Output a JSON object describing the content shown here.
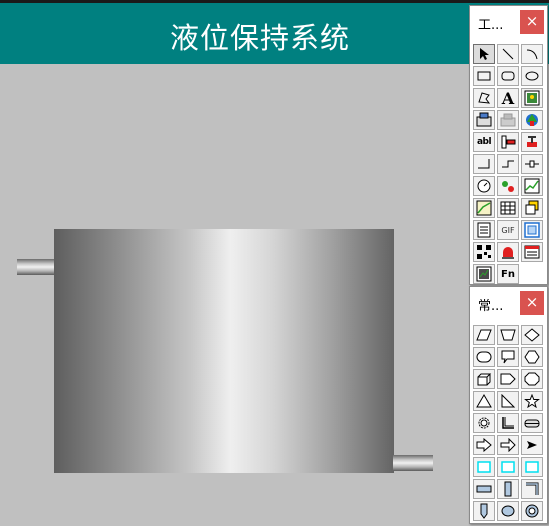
{
  "window": {
    "title": "液位保持系统"
  },
  "palettes": {
    "tools": {
      "title": "工...",
      "close": "×",
      "gif_label": "GIF",
      "text_label": "A",
      "abl_label": "abl",
      "fn_label": "Fn"
    },
    "shapes": {
      "title": "常...",
      "close": "×"
    }
  },
  "colors": {
    "title_bar": "#008080",
    "canvas": "#c0c0c0",
    "close_button": "#d9534f",
    "cyan_shape": "#00e0f0"
  }
}
